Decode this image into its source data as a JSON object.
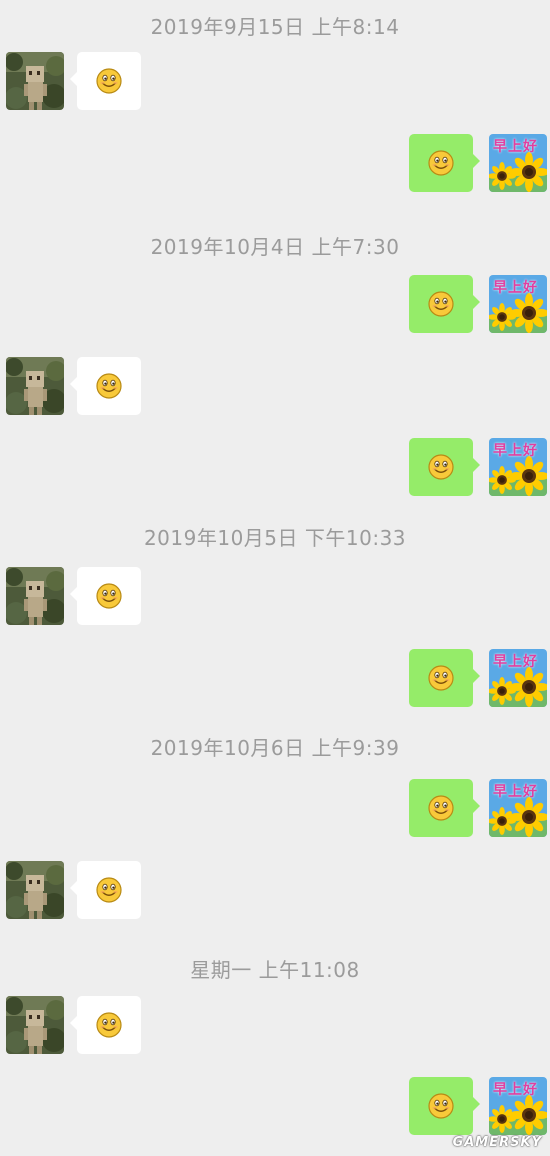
{
  "chat": {
    "timestamps": [
      "2019年9月15日 上午8:14",
      "2019年10月4日 上午7:30",
      "2019年10月5日 下午10:33",
      "2019年10月6日 上午9:39",
      "星期一 上午11:08"
    ],
    "message_icon": "smile-emoji-icon",
    "avatar_text": "早上好",
    "incoming_bubble_color": "#ffffff",
    "outgoing_bubble_color": "#95ec69"
  },
  "watermark": "GAMERSKY"
}
